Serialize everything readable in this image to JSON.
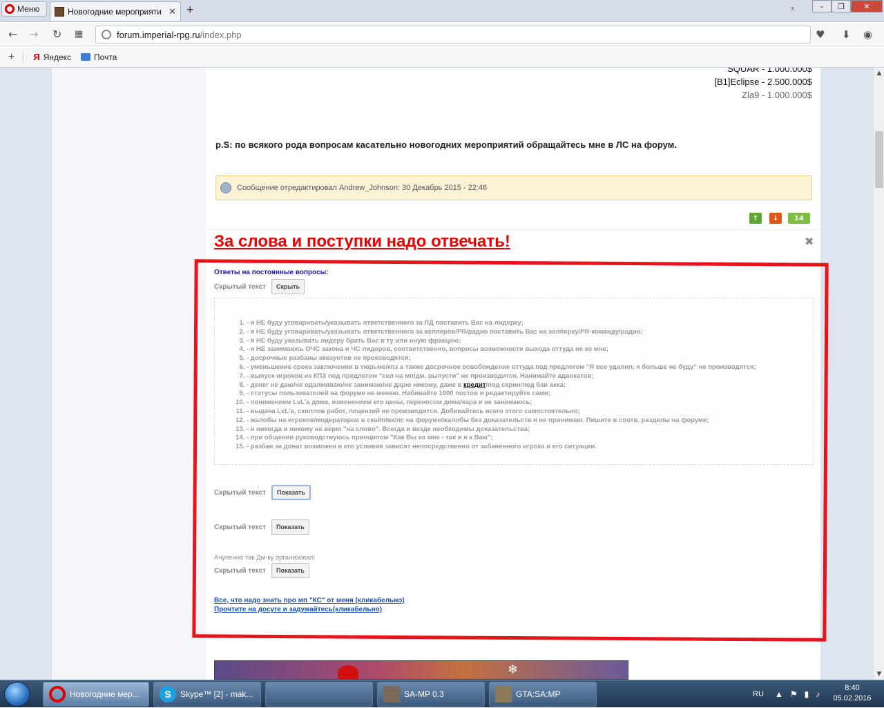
{
  "browser": {
    "menu_label": "Меню",
    "tab_title": "Новогодние мероприяти",
    "url_domain": "forum.imperial-rpg.ru",
    "url_path": "/index.php",
    "bookmarks": [
      {
        "label": "Яндекс",
        "icon": "yandex-icon"
      },
      {
        "label": "Почта",
        "icon": "mail-icon"
      }
    ],
    "accent_color": "#d40000"
  },
  "post": {
    "winners": [
      "SQUAR - 1.000.000$",
      "[B1]Eclipse - 2.500.000$",
      "Zla9 - 1.000.000$"
    ],
    "ps_text": "p.S: по всякого рода вопросам  касательно новогодних мероприятий обращайтесь мне в ЛС на форум.",
    "edit_note": "Сообщение отредактировал Andrew_Johnson: 30 Декабрь 2015 - 22:46",
    "reputation": "14",
    "rep_up_icon": "arrow-up-icon",
    "rep_down_icon": "arrow-down-icon"
  },
  "signature": {
    "title": "За слова и поступки надо отвечать!",
    "faq_header": "Ответы на постоянные вопросы:",
    "spoilers": [
      {
        "label": "Скрытый текст",
        "button": "Скрыть"
      },
      {
        "label": "Скрытый текст",
        "button": "Показать"
      },
      {
        "label": "Скрытый текст",
        "button": "Показать"
      },
      {
        "label": "Скрытый текст",
        "button": "Показать"
      }
    ],
    "rules_before_link": "- денег не даю/не одалживаю/не занимаю/не дарю никому, даже в ",
    "rules_link": "кредит",
    "rules_after_link": "/под скрин/под бан акка;",
    "rules": [
      "- я НЕ буду уговаривать/указывать ответственного за ЛД поставить Вас на лидерку;",
      "- я НЕ буду уговаривать/указывать ответственного за хелперов/PR/радио поставить Вас на хелперку/PR-команду/радио;",
      "- я НЕ буду указывать лидеру брать Вас в ту или иную фракцию;",
      "- я НЕ занимаюсь ОЧС закона и ЧС лидеров, соответственно, вопросы возможности выхода оттуда не ко мне;",
      "- досрочные разбаны аккаунтов не производятся;",
      "- уменьшение срока заключения в тюрьме/кпз а также досрочное освобождение оттуда под предлогом \"Я все удалил, я больше не буду\" не производятся;",
      "- выпуск игроков из КПЗ под предлогом \"сел на мп/дм, выпусти\" не производится. Нанимайте адвокатов;",
      "",
      "- статусы пользователей на форуме не меняю. Набивайте 1000 постов и редактируйте сами;",
      "- понижением LvL'а дома, изменением его цены, переносом дома/кара я не занимаюсь;",
      "- выдача LvL'а, скиллов работ, лицензий не производится. Добивайтесь всего этого самостоятельно;",
      "- жалобы на игроков/модераторов в скайп/вк/лс на форуме/жалобы без доказательств я не принимаю. Пишите в соотв. разделы на форуме;",
      "- я никогда и никому не верю \"на слово\". Всегда и везде необходимы доказательства;",
      "- при общении руководствуюсь принципом \"Как Вы ко мне - так и я к Вам\";",
      "- разбан за донат возможен и его условия зависят непосредственно от забаненного игрока и его ситуации."
    ],
    "acup_text": "Ачупенно так Дм-ку организовал:",
    "link1": "Все, что надо знать про мп \"КС\" от меня (кликабельно)",
    "link2": "Прочтите на досуге и задумайтесь(кликабельно)",
    "highlight_color": "#e8141c"
  },
  "taskbar": {
    "items": [
      {
        "label": "Новогодние мер...",
        "icon": "opera-icon"
      },
      {
        "label": "Skype™ [2] - mak...",
        "icon": "skype-icon"
      },
      {
        "label": "",
        "icon": "blank-window-icon"
      },
      {
        "label": "SA-MP 0.3",
        "icon": "samp-icon"
      },
      {
        "label": "GTA:SA:MP",
        "icon": "gta-icon"
      }
    ],
    "lang": "RU",
    "time": "8:40",
    "date": "05.02.2016"
  }
}
